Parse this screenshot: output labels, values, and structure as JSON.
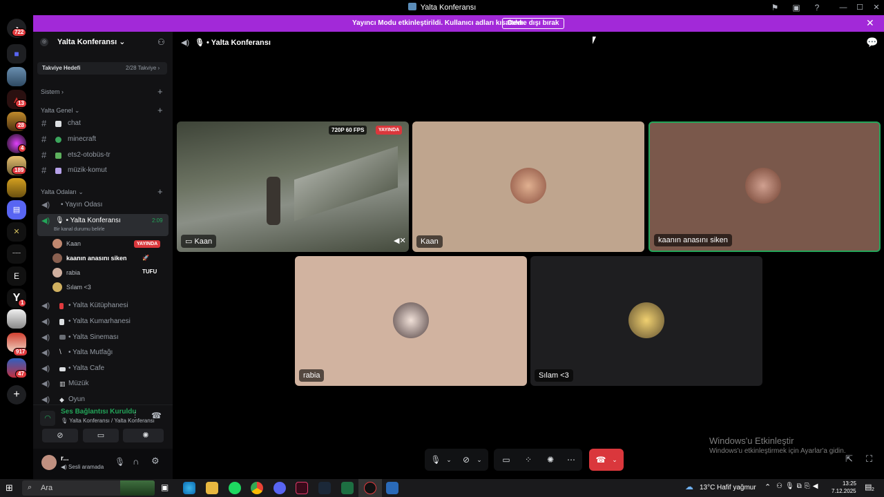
{
  "window": {
    "title": "Yalta Konferansı"
  },
  "banner": {
    "message": "Yayıncı Modu etkinleştirildi. Kullanıcı adları kısaltıldı.",
    "button": "Devre dışı bırak"
  },
  "servers": {
    "badges": [
      "722",
      "13",
      "28",
      "4",
      "189",
      "917",
      "47",
      "1"
    ]
  },
  "sidebar": {
    "server_name": "Yalta Konferansı",
    "boost": {
      "label": "Takviye Hedefi",
      "progress": "2/28 Takviye"
    },
    "categories": [
      "Sistem",
      "Yalta Genel",
      "Yalta Odaları"
    ],
    "text_channels": [
      {
        "label": "chat",
        "emoji_color": "#dbdee1"
      },
      {
        "label": "minecraft",
        "emoji_color": "#3ba55c"
      },
      {
        "label": "ets2-otobüs-tr",
        "emoji_color": "#5db05d"
      },
      {
        "label": "müzik-komut",
        "emoji_color": "#b5a0e8"
      }
    ],
    "voice_channels_top": [
      "Yayın Odası"
    ],
    "active_channel": {
      "label": "Yalta Konferansı",
      "time": "2:09",
      "status": "Bir kanal durumu belirle"
    },
    "members": [
      {
        "name": "Kaan",
        "tag": "YAYINDA"
      },
      {
        "name": "kaanın anasını siken",
        "tag": "TUFU"
      },
      {
        "name": "rabia",
        "tag": ""
      },
      {
        "name": "Sılam <3",
        "tag": ""
      }
    ],
    "voice_channels_bottom": [
      "Yalta Kütüphanesi",
      "Yalta Kumarhanesi",
      "Yalta Sineması",
      "Yalta Mutfağı",
      "Yalta Cafe",
      "Müzük",
      "Oyun"
    ]
  },
  "voice_panel": {
    "status": "Ses Bağlantısı Kuruldu",
    "location": "Yalta Konferansı / Yalta Konferansı",
    "user_name": "r...",
    "user_status": "Sesli aramada"
  },
  "stage": {
    "header_title": "Yalta Konferansı",
    "stream": {
      "quality": "720P 60 FPS",
      "live": "YAYINDA",
      "name": "Kaan"
    },
    "tiles": [
      {
        "name": "Kaan",
        "bg": "#bfa58e"
      },
      {
        "name": "kaanın anasını siken",
        "bg": "#7a584b"
      },
      {
        "name": "rabia",
        "bg": "#d1b3a0"
      },
      {
        "name": "Sılam <3",
        "bg": "#1e1e20"
      }
    ]
  },
  "watermark": {
    "title": "Windows'u Etkinleştir",
    "subtitle": "Windows'u etkinleştirmek için Ayarlar'a gidin."
  },
  "taskbar": {
    "search_placeholder": "Ara",
    "weather": "13°C",
    "weather_desc": "Hafif yağmur",
    "time": "13:25",
    "date": "7.12.2025",
    "notif": "2"
  },
  "colors": {
    "accent": "#a229d8",
    "connected": "#23a559",
    "hangup": "#da373c"
  }
}
